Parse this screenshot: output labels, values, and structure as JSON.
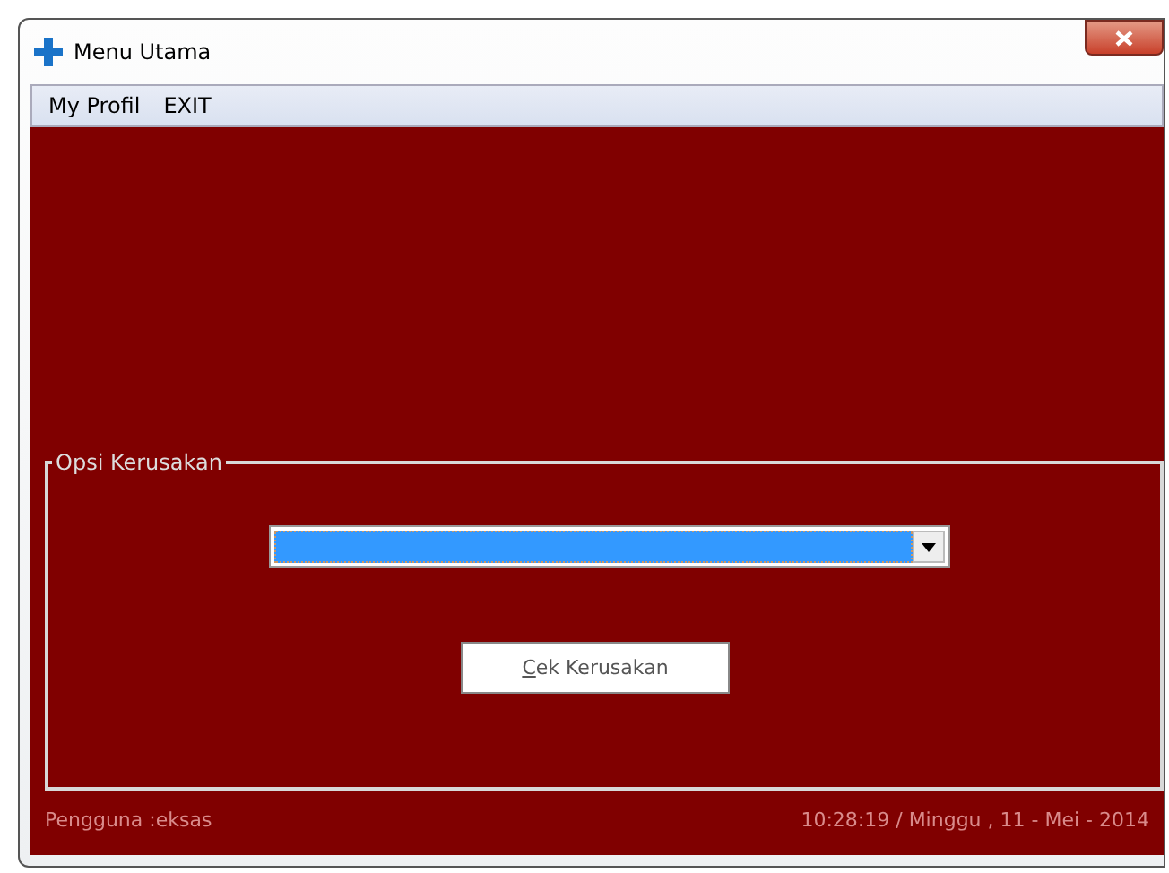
{
  "window": {
    "title": "Menu Utama"
  },
  "menu": [
    {
      "label": "My Profil"
    },
    {
      "label": "EXIT"
    }
  ],
  "group": {
    "title": "Opsi Kerusakan",
    "button": "Cek Kerusakan"
  },
  "status_bar": {
    "user": "Pengguna :eksas",
    "datetime": "10:28:19 / Minggu , 11 - Mei - 2014"
  }
}
